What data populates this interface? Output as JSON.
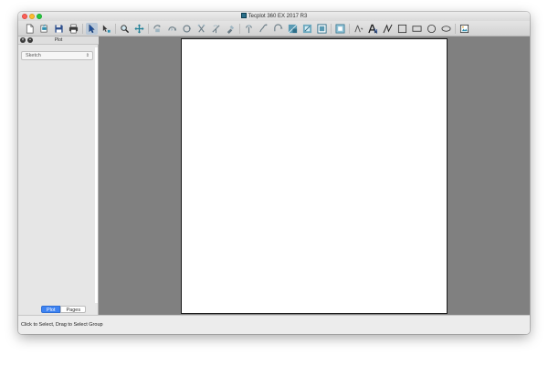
{
  "window": {
    "title": "Tecplot 360 EX 2017 R3"
  },
  "toolbar": {
    "icons": [
      "new-layout-icon",
      "open-layout-icon",
      "save-layout-icon",
      "print-icon",
      "selector-icon",
      "adjustor-icon",
      "zoom-icon",
      "translate-icon",
      "rotate-3d-icon",
      "rotate-spherical-icon",
      "rotate-rollerball-icon",
      "rotate-twist-icon",
      "rotate-about-axis-icon",
      "probe-icon",
      "contour-icon",
      "streamtrace-icon",
      "slice-icon",
      "iso-surface-icon",
      "extract-icon",
      "zone-icon",
      "blanking-icon",
      "axis-icon",
      "text-icon",
      "polyline-icon",
      "rectangle-icon",
      "circle-icon",
      "ellipse-icon",
      "image-icon"
    ],
    "active_icon": "selector-icon"
  },
  "sidebar": {
    "title": "Plot",
    "plot_type": "Sketch",
    "tabs": [
      "Plot",
      "Pages"
    ],
    "selected_tab": "Plot"
  },
  "status": {
    "text": "Click to Select, Drag to Select Group"
  },
  "colors": {
    "workspace": "#808080",
    "paper": "#ffffff",
    "selected_tab": "#3e83f2",
    "icon_teal": "#1e7f96"
  }
}
